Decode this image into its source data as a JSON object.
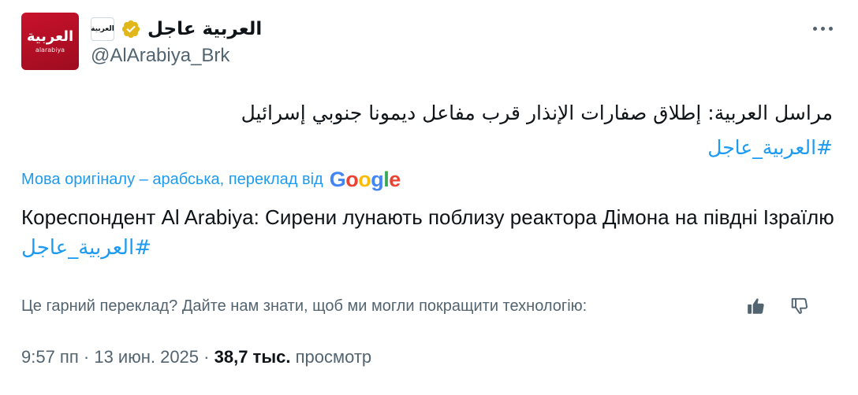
{
  "account": {
    "avatar_logo": "العربية",
    "avatar_sub": "alarabiya",
    "affiliate_badge": "العربية",
    "display_name": "العربية عاجل",
    "handle": "@AlArabiya_Brk"
  },
  "tweet": {
    "text_line1": "مراسل العربية: إطلاق صفارات الإنذار قرب مفاعل ديمونا جنوبي إسرائيل",
    "hashtag": "#العربية_عاجل"
  },
  "translation": {
    "by_label": "Мова оригіналу – арабська, переклад від",
    "google": [
      "G",
      "o",
      "o",
      "g",
      "l",
      "e"
    ],
    "text": "Кореспондент Al Arabiya: Сирени лунають поблизу реактора Дімона на півдні Ізраїлю",
    "hashtag": "#العربية_عاجل",
    "feedback_question": "Це гарний переклад? Дайте нам знати, щоб ми могли покращити технологію:"
  },
  "meta": {
    "time": "9:57 пп",
    "separator": "·",
    "date": "13 июн. 2025",
    "views_count": "38,7 тыс.",
    "views_label": "просмотр"
  },
  "colors": {
    "accent": "#1d9bf0",
    "secondary_text": "#536471",
    "brand_red": "#c8122b",
    "verified_gold": "#e2b719"
  },
  "icons": {
    "more": "more-horizontal-icon",
    "verified": "verified-gold-badge-icon",
    "thumbs_up": "thumbs-up-icon",
    "thumbs_down": "thumbs-down-icon"
  }
}
